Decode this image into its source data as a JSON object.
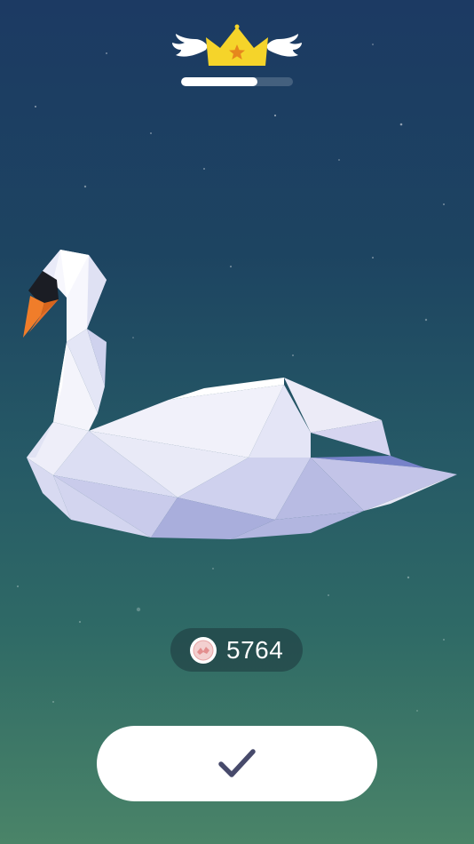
{
  "colors": {
    "bg_top": "#1c3a63",
    "bg_bottom": "#4a8468",
    "crown": "#f5d42a",
    "crown_star": "#e6871d",
    "beak": "#f07d2a",
    "check": "#474a6b"
  },
  "rank": {
    "icon": "winged-crown-icon",
    "progress_fraction": 0.68
  },
  "creature": {
    "icon": "low-poly-swan"
  },
  "coins": {
    "icon": "coin-icon",
    "value": "5764"
  },
  "confirm_button": {
    "icon": "checkmark-icon"
  }
}
